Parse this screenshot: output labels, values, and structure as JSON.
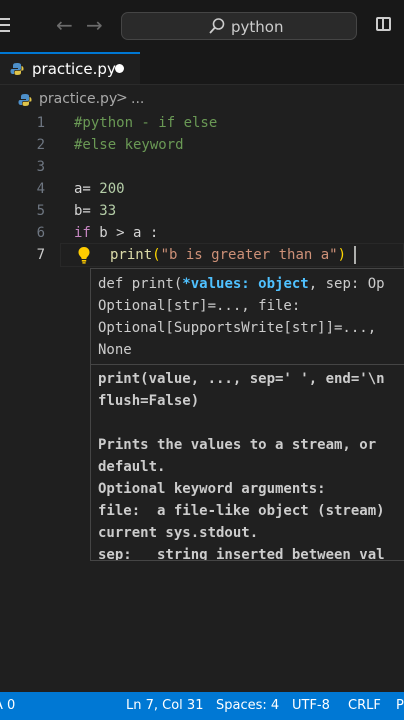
{
  "titlebar": {
    "search_text": "python"
  },
  "tab": {
    "label": "practice.py"
  },
  "breadcrumb": {
    "file": "practice.py",
    "separator": ">",
    "ellipsis": "..."
  },
  "editor": {
    "line_numbers": [
      "1",
      "2",
      "3",
      "4",
      "5",
      "6",
      "7"
    ],
    "line1": "#python - if else",
    "line2": "#else keyword",
    "line4_var": "a=",
    "line4_val": "200",
    "line5_var": "b=",
    "line5_val": "33",
    "line6_kw": "if",
    "line6_rest": "b > a :",
    "line7_fn": "print",
    "line7_open": "(",
    "line7_str": "\"b is greater than a\"",
    "line7_close": ")"
  },
  "tooltip": {
    "sig_line1_prefix": "def print(",
    "sig_line1_param": "*values: object",
    "sig_line1_suffix": ", sep: Op",
    "sig_line2": "Optional[str]=..., file:",
    "sig_line3": "Optional[SupportsWrite[str]]=...,",
    "sig_line4": "None",
    "doc_lines": [
      "print(value, ..., sep=' ', end='\\n",
      "flush=False)",
      "",
      "Prints the values to a stream, or",
      "default.",
      "Optional keyword arguments:",
      "file:  a file-like object (stream)",
      "current sys.stdout.",
      "sep:   string inserted between val"
    ]
  },
  "statusbar": {
    "problems": "A 0",
    "position": "Ln 7, Col 31",
    "spaces": "Spaces: 4",
    "encoding": "UTF-8",
    "eol": "CRLF",
    "language": "P"
  }
}
